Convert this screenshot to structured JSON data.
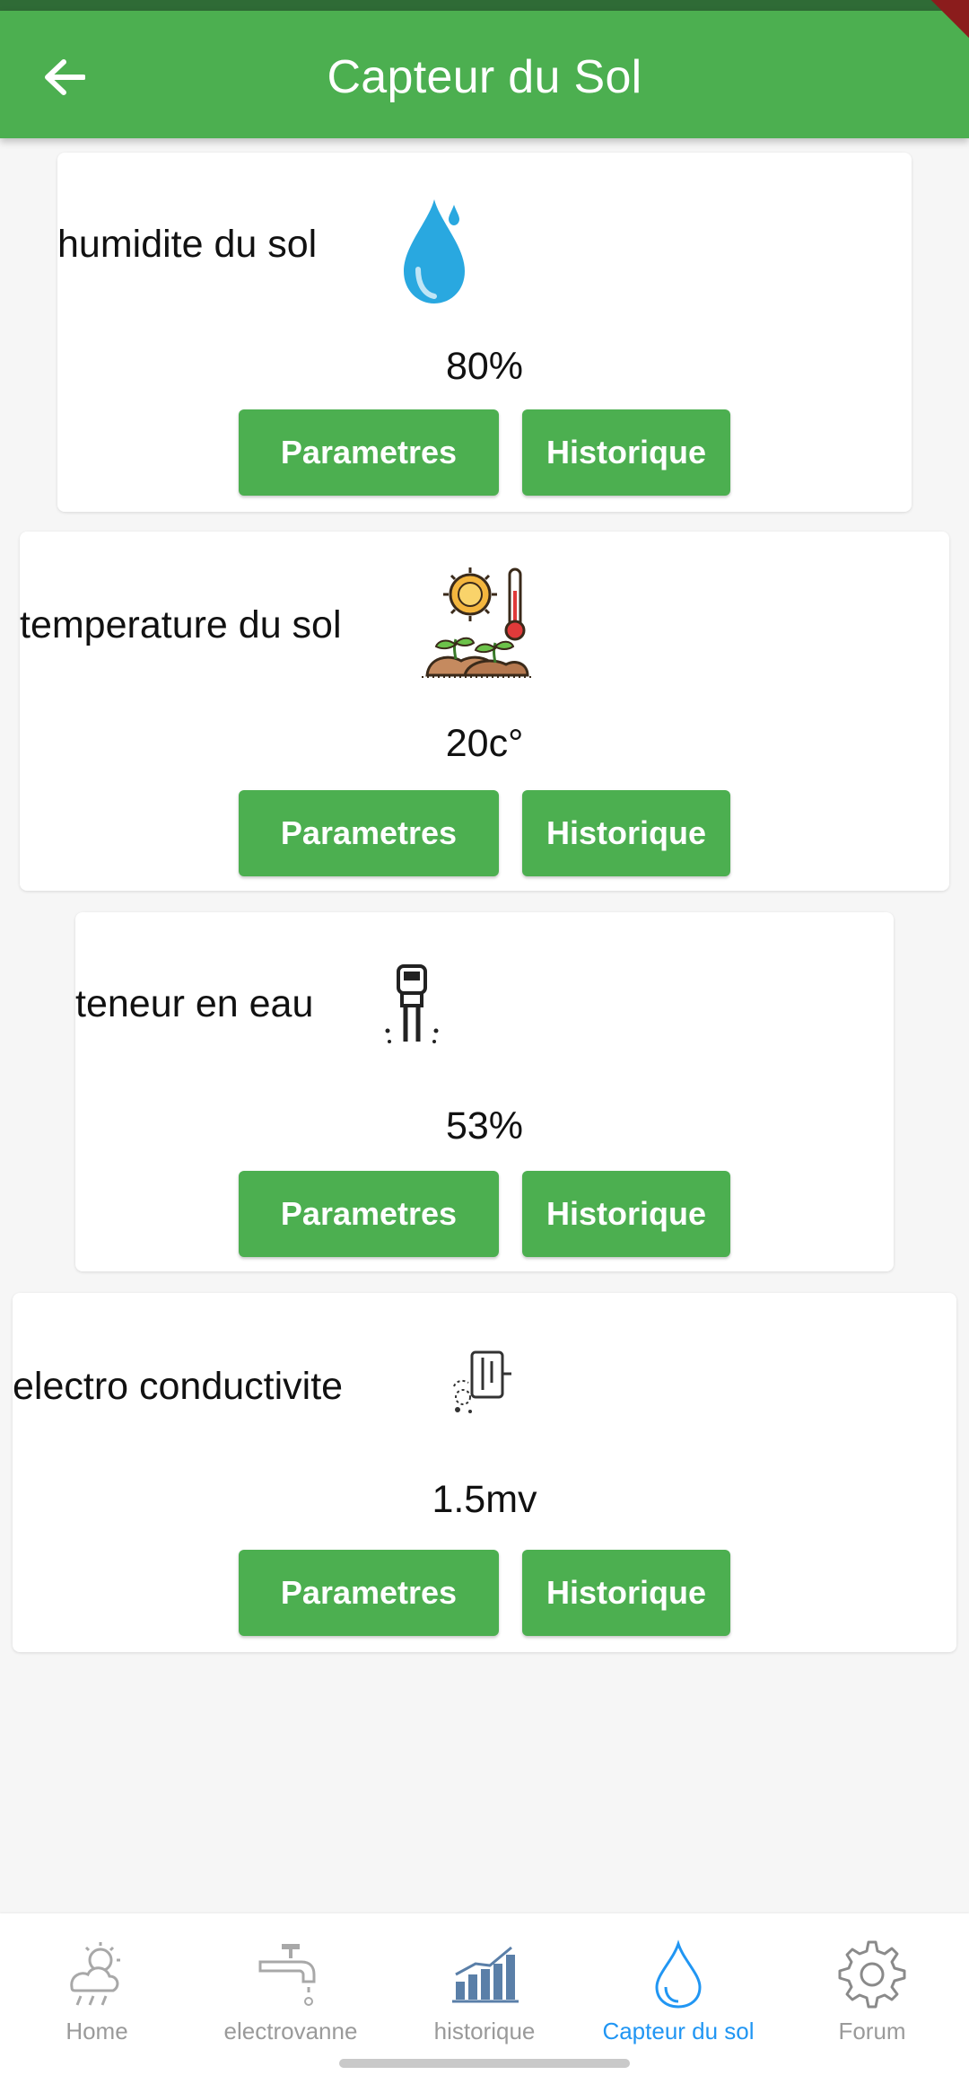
{
  "app_bar": {
    "title": "Capteur du Sol"
  },
  "cards": [
    {
      "title": "humidite du sol",
      "icon": "water-drop-icon",
      "value": "80%",
      "params_label": "Parametres",
      "history_label": "Historique"
    },
    {
      "title": "temperature du sol",
      "icon": "soil-temperature-icon",
      "value": "20c°",
      "params_label": "Parametres",
      "history_label": "Historique"
    },
    {
      "title": "teneur en eau",
      "icon": "moisture-probe-icon",
      "value": "53%",
      "params_label": "Parametres",
      "history_label": "Historique"
    },
    {
      "title": "electro conductivite",
      "icon": "conductivity-meter-icon",
      "value": "1.5mv",
      "params_label": "Parametres",
      "history_label": "Historique"
    }
  ],
  "bottom_nav": {
    "items": [
      {
        "label": "Home",
        "icon": "weather-icon"
      },
      {
        "label": "electrovanne",
        "icon": "faucet-icon"
      },
      {
        "label": "historique",
        "icon": "bar-chart-icon"
      },
      {
        "label": "Capteur du sol",
        "icon": "water-drop-outline-icon",
        "active": true
      },
      {
        "label": "Forum",
        "icon": "gear-icon"
      }
    ]
  },
  "colors": {
    "primary": "#4caf50",
    "active_nav": "#2196f3",
    "inactive_nav": "#9a9a9a"
  }
}
